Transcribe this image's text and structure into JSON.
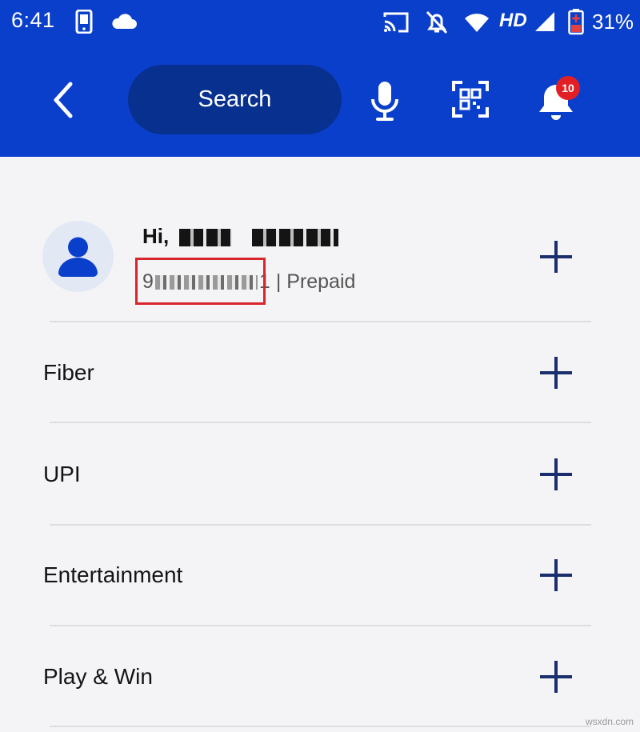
{
  "status_bar": {
    "time": "6:41",
    "network": "HD",
    "battery": "31%",
    "icons": [
      "phone-icon",
      "cloud-icon",
      "cast-icon",
      "mute-icon",
      "wifi-icon",
      "signal-icon",
      "battery-icon"
    ]
  },
  "toolbar": {
    "search_label": "Search",
    "notification_count": "10",
    "icons": [
      "back-arrow-icon",
      "microphone-icon",
      "qr-scan-icon",
      "bell-icon"
    ]
  },
  "profile": {
    "greeting_prefix": "Hi,",
    "phone_first_digit": "9",
    "phone_last_digit": "1",
    "plan_suffix": "| Prepaid"
  },
  "menu": {
    "items": [
      {
        "label": "Fiber"
      },
      {
        "label": "UPI"
      },
      {
        "label": "Entertainment"
      },
      {
        "label": "Play & Win"
      }
    ]
  },
  "colors": {
    "appbar": "#0a3fcb",
    "search_pill": "#08308f",
    "plus_icon": "#1a2e6e",
    "badge": "#e11f25",
    "highlight": "#d9262c"
  },
  "watermark": "wsxdn.com"
}
